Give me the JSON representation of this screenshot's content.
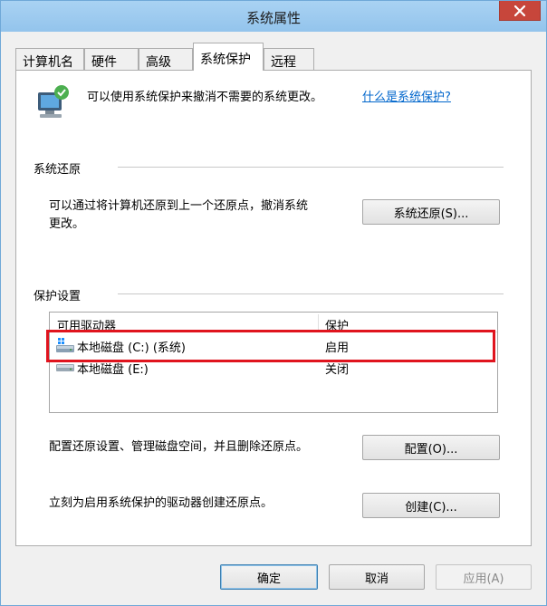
{
  "window": {
    "title": "系统属性"
  },
  "tabs": [
    {
      "label": "计算机名",
      "active": false
    },
    {
      "label": "硬件",
      "active": false
    },
    {
      "label": "高级",
      "active": false
    },
    {
      "label": "系统保护",
      "active": true
    },
    {
      "label": "远程",
      "active": false
    }
  ],
  "intro": {
    "text": "可以使用系统保护来撤消不需要的系统更改。",
    "link": "什么是系统保护?"
  },
  "restore": {
    "heading": "系统还原",
    "text_line1": "可以通过将计算机还原到上一个还原点，撤消系统",
    "text_line2": "更改。",
    "button": "系统还原(S)..."
  },
  "protection": {
    "heading": "保护设置",
    "columns": [
      "可用驱动器",
      "保护"
    ],
    "drives": [
      {
        "name": "本地磁盘 (C:) (系统)",
        "status": "启用",
        "icon": "system-drive-icon"
      },
      {
        "name": "本地磁盘 (E:)",
        "status": "关闭",
        "icon": "local-drive-icon"
      }
    ]
  },
  "configure": {
    "text": "配置还原设置、管理磁盘空间，并且删除还原点。",
    "button": "配置(O)..."
  },
  "create": {
    "text": "立刻为启用系统保护的驱动器创建还原点。",
    "button": "创建(C)..."
  },
  "footer": {
    "ok": "确定",
    "cancel": "取消",
    "apply": "应用(A)"
  },
  "colors": {
    "titlebar": "#a9d2f3",
    "close": "#c7463b",
    "link": "#0066cc",
    "highlight": "#e0141e"
  }
}
